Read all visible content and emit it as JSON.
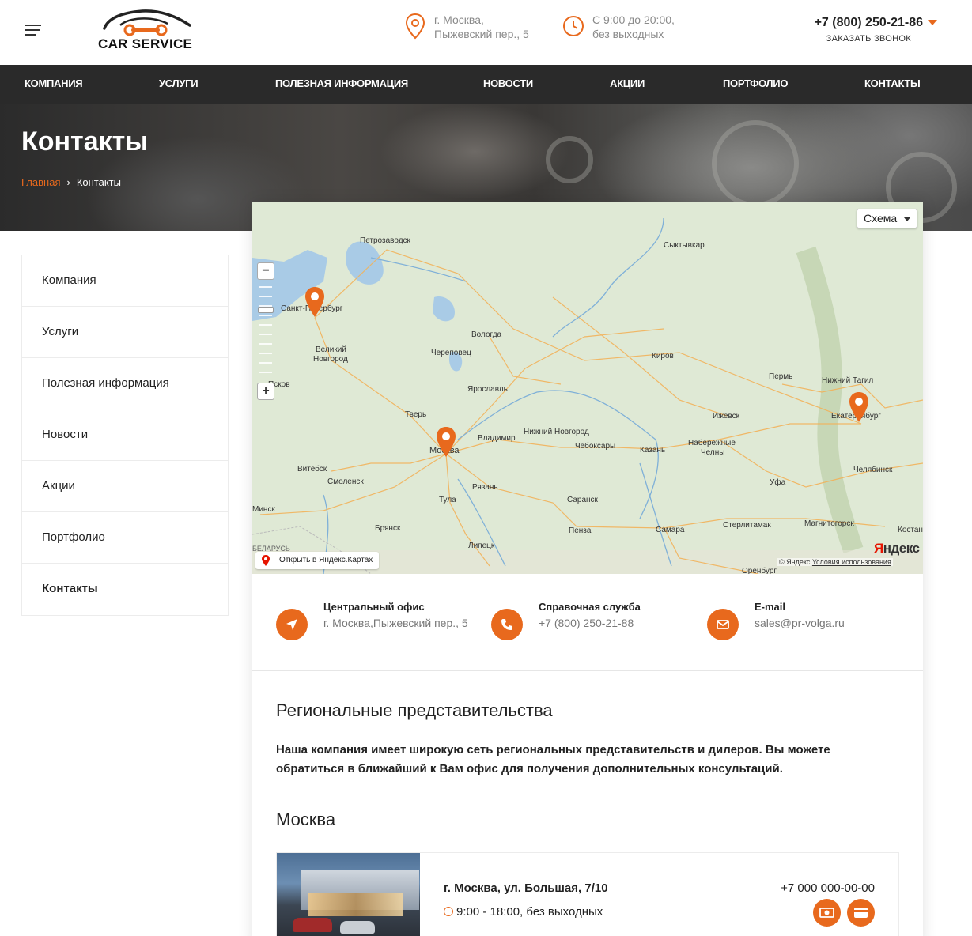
{
  "header": {
    "logo_text": "CAR SERVICE",
    "address_line1": "г. Москва,",
    "address_line2": "Пыжевский пер., 5",
    "hours_line1": "С 9:00 до 20:00,",
    "hours_line2": "без выходных",
    "phone": "+7 (800) 250-21-86",
    "callback": "ЗАКАЗАТЬ ЗВОНОК"
  },
  "nav": [
    {
      "label": "КОМПАНИЯ"
    },
    {
      "label": "УСЛУГИ"
    },
    {
      "label": "ПОЛЕЗНАЯ ИНФОРМАЦИЯ"
    },
    {
      "label": "НОВОСТИ"
    },
    {
      "label": "АКЦИИ"
    },
    {
      "label": "ПОРТФОЛИО"
    },
    {
      "label": "КОНТАКТЫ"
    }
  ],
  "hero": {
    "title": "Контакты",
    "breadcrumb_home": "Главная",
    "breadcrumb_sep": "›",
    "breadcrumb_current": "Контакты"
  },
  "sidebar": {
    "items": [
      {
        "label": "Компания"
      },
      {
        "label": "Услуги"
      },
      {
        "label": "Полезная информация"
      },
      {
        "label": "Новости"
      },
      {
        "label": "Акции"
      },
      {
        "label": "Портфолио"
      },
      {
        "label": "Контакты"
      }
    ]
  },
  "map": {
    "scheme_label": "Схема",
    "open_label": "Открыть в Яндекс.Картах",
    "logo_y": "Я",
    "logo_rest": "ндекс",
    "copyright": "© Яндекс",
    "terms": "Условия использования",
    "cities": {
      "petrozavodsk": "Петрозаводск",
      "syktyvkar": "Сыктывкар",
      "spb": "Санкт-Петербург",
      "vnovgorod1": "Великий",
      "vnovgorod2": "Новгород",
      "vologda": "Вологда",
      "cherepovets": "Череповец",
      "kirov": "Киров",
      "pskov": "Псков",
      "perm": "Пермь",
      "ntagil": "Нижний Тагил",
      "yaroslavl": "Ярославль",
      "tver": "Тверь",
      "izhevsk": "Ижевск",
      "ekb": "Екатеринбург",
      "vladimir": "Владимир",
      "nnovgorod": "Нижний Новгород",
      "cheboksary": "Чебоксары",
      "moscow": "Москва",
      "nchelny1": "Набережные",
      "nchelny2": "Челны",
      "kazan": "Казань",
      "vitebsk": "Витебск",
      "chelyabinsk": "Челябинск",
      "smolensk": "Смоленск",
      "ryazan": "Рязань",
      "ufa": "Уфа",
      "tula": "Тула",
      "saransk": "Саранск",
      "minsk": "Минск",
      "bryansk": "Брянск",
      "penza": "Пенза",
      "samara": "Самара",
      "sterlitamak": "Стерлитамак",
      "magnitogorsk": "Магнитогорск",
      "kostanay": "Костан",
      "lipetsk": "Липецк",
      "orenburg": "Оренбург",
      "belarus": "БЕЛАРУСЬ"
    }
  },
  "contacts": [
    {
      "title": "Центральный офис",
      "text": "г. Москва,Пыжевский пер., 5"
    },
    {
      "title": "Справочная служба",
      "text": "+7 (800) 250-21-88"
    },
    {
      "title": "E-mail",
      "text": "sales@pr-volga.ru"
    }
  ],
  "regional": {
    "title": "Региональные представительства",
    "description": "Наша компания имеет широкую сеть региональных представительств и дилеров. Вы можете обратиться в ближайший к Вам офис для получения дополнительных консультаций.",
    "city": "Москва",
    "office": {
      "address": "г. Москва, ул. Большая, 7/10",
      "hours": "9:00 - 18:00, без выходных",
      "phone": "+7 000 000-00-00"
    }
  },
  "colors": {
    "accent": "#e8691d",
    "nav_bg": "#2a2a2a"
  }
}
